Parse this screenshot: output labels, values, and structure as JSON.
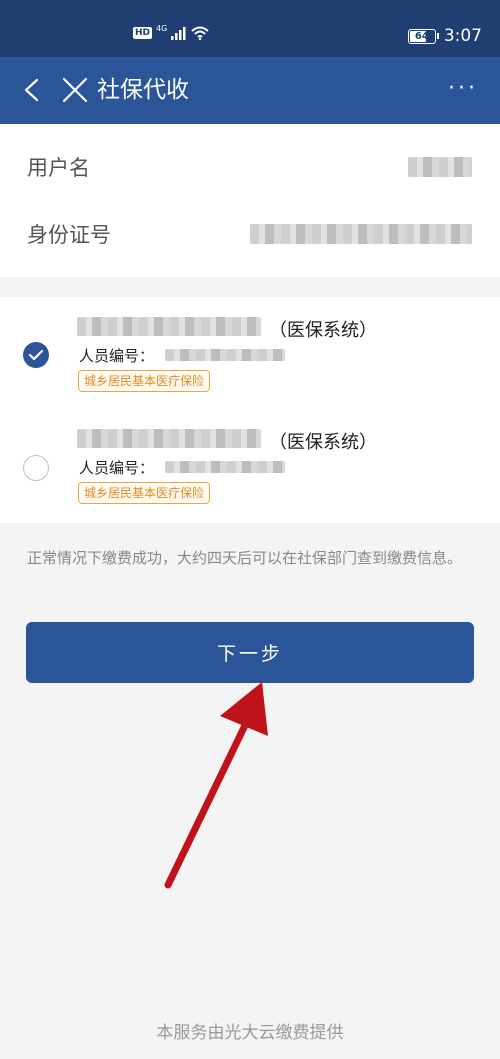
{
  "status_bar": {
    "hd_label": "HD",
    "network_label": "4G",
    "battery_level": "64",
    "time": "3:07"
  },
  "nav": {
    "title": "社保代收",
    "more_label": "···"
  },
  "info": {
    "username_label": "用户名",
    "id_number_label": "身份证号"
  },
  "accounts": [
    {
      "system_label": "（医保系统）",
      "id_label": "人员编号：",
      "insurance_type": "城乡居民基本医疗保险",
      "selected": true
    },
    {
      "system_label": "（医保系统）",
      "id_label": "人员编号：",
      "insurance_type": "城乡居民基本医疗保险",
      "selected": false
    }
  ],
  "notice": "正常情况下缴费成功，大约四天后可以在社保部门查到缴费信息。",
  "next_button_label": "下一步",
  "footer": "本服务由光大云缴费提供",
  "colors": {
    "status_bar": "#1f3f72",
    "nav_bar": "#2a5599",
    "primary_button": "#2a5599",
    "tag_border": "#e8a64c",
    "annotation_arrow": "#c0121b"
  }
}
